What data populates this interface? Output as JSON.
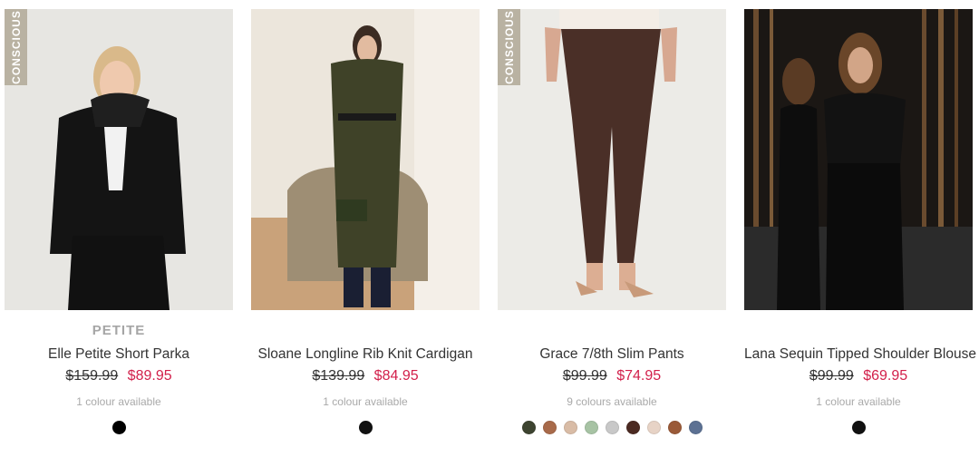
{
  "products": [
    {
      "badge": "CONSCIOUS",
      "tag": "PETITE",
      "name": "Elle Petite Short Parka",
      "price_was": "$159.99",
      "price_now": "$89.95",
      "colours": "1 colour available",
      "swatches": [
        "#000000"
      ]
    },
    {
      "badge": "",
      "tag": "",
      "name": "Sloane Longline Rib Knit Cardigan",
      "price_was": "$139.99",
      "price_now": "$84.95",
      "colours": "1 colour available",
      "swatches": [
        "#111111"
      ]
    },
    {
      "badge": "CONSCIOUS",
      "tag": "",
      "name": "Grace 7/8th Slim Pants",
      "price_was": "$99.99",
      "price_now": "$74.95",
      "colours": "9 colours available",
      "swatches": [
        "#3d4430",
        "#a86a4a",
        "#d9bca6",
        "#a7c3a4",
        "#c8c8c8",
        "#4b2a22",
        "#e7d3c6",
        "#9a5a38",
        "#5c7193"
      ]
    },
    {
      "badge": "",
      "tag": "",
      "name": "Lana Sequin Tipped Shoulder Blouse",
      "price_was": "$99.99",
      "price_now": "$69.95",
      "colours": "1 colour available",
      "swatches": [
        "#111111"
      ]
    }
  ]
}
